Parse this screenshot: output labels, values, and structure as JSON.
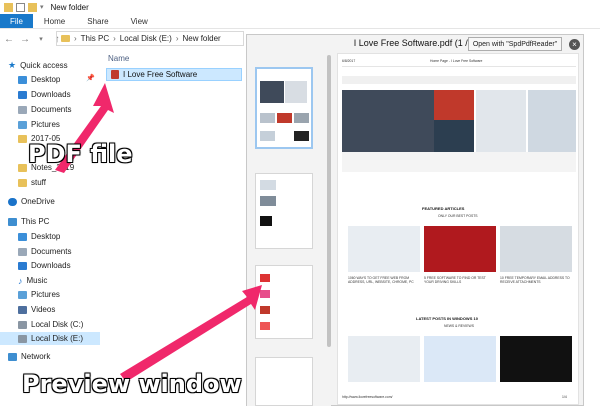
{
  "window": {
    "title": "New folder"
  },
  "ribbon": {
    "tabs": [
      "File",
      "Home",
      "Share",
      "View"
    ]
  },
  "address": {
    "crumbs": [
      "This PC",
      "Local Disk (E:)",
      "New folder"
    ]
  },
  "sidebar": {
    "quick_access": "Quick access",
    "items": [
      "Desktop",
      "Downloads",
      "Documents",
      "Pictures",
      "2017-05",
      "Notes_2019",
      "stuff"
    ],
    "onedrive": "OneDrive",
    "this_pc": "This PC",
    "pc_items": [
      "Desktop",
      "Documents",
      "Downloads",
      "Music",
      "Pictures",
      "Videos",
      "Local Disk (C:)",
      "Local Disk (E:)"
    ],
    "network": "Network"
  },
  "filelist": {
    "column_name": "Name",
    "files": [
      "I Love Free Software"
    ]
  },
  "preview": {
    "title": "I Love Free Software.pdf (1 / 4)",
    "open_button": "Open with \"SpdPdfReader\"",
    "close_glyph": "×",
    "page": {
      "date": "6/8/2017",
      "site_title": "Home Page - I Love Free Software",
      "featured": "FEATURED ARTICLES",
      "featured_sub": "ONLY OUR BEST POSTS",
      "latest": "LATEST POSTS IN WINDOWS 10",
      "latest_sub": "NEWS & REVIEWS",
      "article1": "1060 WAYS TO GET FREE WEB FROM ADDRESS, URL, WEBSITE, CHROME, PC",
      "article2": "5 FREE SOFTWARE TO FIND OR TEST YOUR DRIVING SKILLS",
      "article3": "10 FREE TEMPORARY EMAIL ADDRESS TO RECEIVE ATTACHMENTS",
      "url": "http://www.ilovefreesoftware.com/",
      "page_num": "1/4"
    }
  },
  "annotations": {
    "pdf_label": "PDF file",
    "preview_label": "Preview window",
    "arrow_color": "#f0286b"
  },
  "colors": {
    "accent": "#1979ca",
    "selection": "#cce8ff",
    "folder": "#e8c15a"
  }
}
